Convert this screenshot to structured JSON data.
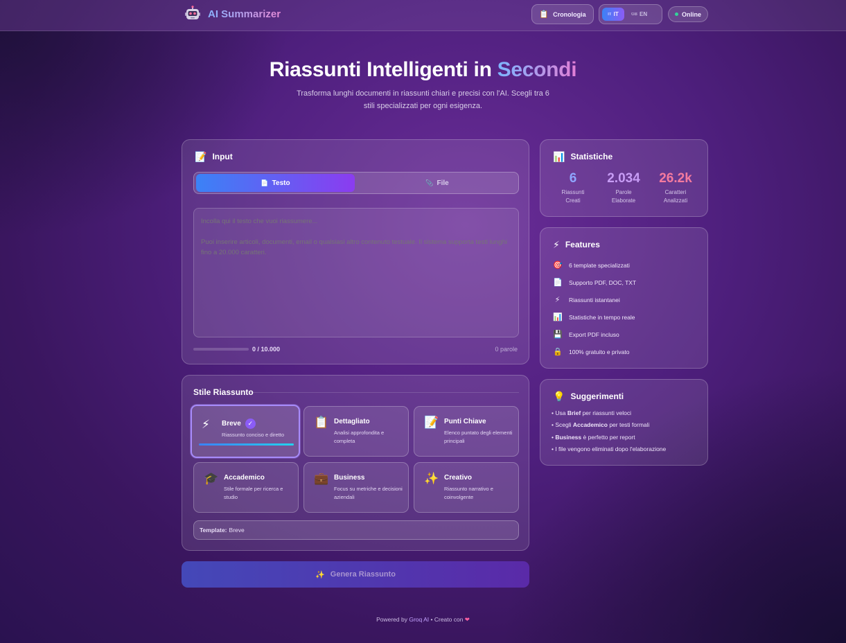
{
  "header": {
    "app_name": "AI Summarizer",
    "history_label": "Cronologia",
    "lang_it": "IT",
    "lang_it_flag": "IT",
    "lang_en": "EN",
    "lang_en_flag": "GB",
    "status": "Online"
  },
  "hero": {
    "title_main": "Riassunti Intelligenti in ",
    "title_accent": "Secondi",
    "subtitle": "Trasforma lunghi documenti in riassunti chiari e precisi con l'AI. Scegli tra 6 stili specializzati per ogni esigenza."
  },
  "input": {
    "title": "Input",
    "tab_text": "Testo",
    "tab_file": "File",
    "placeholder": "Incolla qui il testo che vuoi riassumere...\n\nPuoi inserire articoli, documenti, email o qualsiasi altro contenuto testuale. Il sistema supporta testi lunghi fino a 20.000 caratteri.",
    "char_count": "0 / 10.000",
    "progress": 0,
    "word_count": "0 parole"
  },
  "style": {
    "title": "Stile Riassunto",
    "templates": [
      {
        "name": "Breve",
        "desc": "Riassunto conciso e diretto",
        "icon": "lightning-icon",
        "emoji": "⚡",
        "selected": true
      },
      {
        "name": "Dettagliato",
        "desc": "Analisi approfondita e completa",
        "icon": "clipboard-icon",
        "emoji": "📋",
        "selected": false
      },
      {
        "name": "Punti Chiave",
        "desc": "Elenco puntato degli elementi principali",
        "icon": "memo-icon",
        "emoji": "📝",
        "selected": false
      },
      {
        "name": "Accademico",
        "desc": "Stile formale per ricerca e studio",
        "icon": "graduation-cap-icon",
        "emoji": "🎓",
        "selected": false
      },
      {
        "name": "Business",
        "desc": "Focus su metriche e decisioni aziendali",
        "icon": "briefcase-icon",
        "emoji": "💼",
        "selected": false
      },
      {
        "name": "Creativo",
        "desc": "Riassunto narrativo e coinvolgente",
        "icon": "sparkles-icon",
        "emoji": "✨",
        "selected": false
      }
    ],
    "template_label": "Template:",
    "template_value": "Breve"
  },
  "generate_label": "Genera Riassunto",
  "stats": {
    "title": "Statistiche",
    "items": [
      {
        "value": "6",
        "label": "Riassunti Creati",
        "color": "#8fa6ff"
      },
      {
        "value": "2.034",
        "label": "Parole Elaborate",
        "color": "#c79cf5"
      },
      {
        "value": "26.2k",
        "label": "Caratteri Analizzati",
        "color": "#f47a9e"
      }
    ]
  },
  "features": {
    "title": "Features",
    "items": [
      {
        "emoji": "🎯",
        "icon": "target-icon",
        "text": "6 template specializzati"
      },
      {
        "emoji": "📄",
        "icon": "document-icon",
        "text": "Supporto PDF, DOC, TXT"
      },
      {
        "emoji": "⚡",
        "icon": "lightning-icon",
        "text": "Riassunti istantanei"
      },
      {
        "emoji": "📊",
        "icon": "bar-chart-icon",
        "text": "Statistiche in tempo reale"
      },
      {
        "emoji": "💾",
        "icon": "floppy-disk-icon",
        "text": "Export PDF incluso"
      },
      {
        "emoji": "🔒",
        "icon": "lock-icon",
        "text": "100% gratuito e privato"
      }
    ]
  },
  "tips": {
    "title": "Suggerimenti",
    "items": [
      {
        "pre": "• Usa ",
        "bold": "Brief",
        "post": " per riassunti veloci"
      },
      {
        "pre": "• Scegli ",
        "bold": "Accademico",
        "post": " per testi formali"
      },
      {
        "pre": "• ",
        "bold": "Business",
        "post": " è perfetto per report"
      },
      {
        "pre": "• I file vengono eliminati dopo l'elaborazione",
        "bold": "",
        "post": ""
      }
    ]
  },
  "footer": {
    "pre": "Powered by ",
    "brand": "Groq AI",
    "mid": " • Creato con ",
    "heart": "❤"
  }
}
